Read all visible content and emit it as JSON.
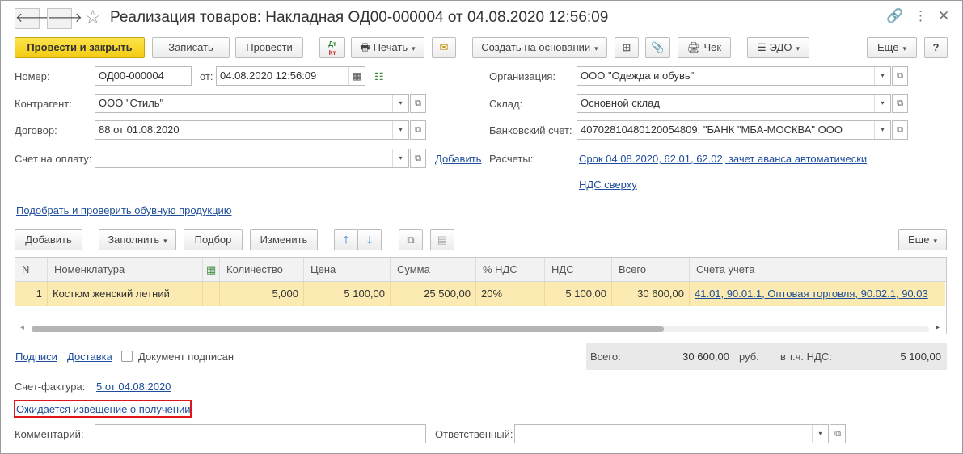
{
  "window": {
    "title": "Реализация товаров: Накладная ОД00-000004 от 04.08.2020 12:56:09",
    "icons": [
      "back-arrow-icon",
      "forward-arrow-icon",
      "star-icon",
      "link-icon",
      "more-vertical-icon",
      "close-icon"
    ],
    "glyphs": {
      "back": "🡐",
      "forward": "🡒",
      "star": "☆",
      "link": "🔗",
      "more": "⋮",
      "close": "✕"
    }
  },
  "toolbar": {
    "post_close": "Провести и закрыть",
    "save": "Записать",
    "post": "Провести",
    "dtkt_top": "Дт",
    "dtkt_bottom": "Кт",
    "print": "Печать",
    "create_based": "Создать на основании",
    "receipt": "Чек",
    "edo": "ЭДО",
    "more": "Еще",
    "help": "?",
    "print_glyph": "🖶",
    "mail_glyph": "✉",
    "struct_glyph": "⊞",
    "clip_glyph": "📎",
    "receipt_glyph": "🖨",
    "edo_glyph": "☰",
    "arrow_glyph": "▾"
  },
  "form": {
    "number_label": "Номер:",
    "number_value": "ОД00-000004",
    "date_label": "от:",
    "date_value": "04.08.2020 12:56:09",
    "calendar_glyph": "▦",
    "status_glyph": "☷",
    "org_label": "Организация:",
    "org_value": "ООО \"Одежда и обувь\"",
    "contractor_label": "Контрагент:",
    "contractor_value": "ООО \"Стиль\"",
    "warehouse_label": "Склад:",
    "warehouse_value": "Основной склад",
    "contract_label": "Договор:",
    "contract_value": "88 от 01.08.2020",
    "bank_label": "Банковский счет:",
    "bank_value": "40702810480120054809, \"БАНК \"МБА-МОСКВА\" ООО",
    "invoice_pay_label": "Счет на оплату:",
    "invoice_pay_value": "",
    "add_link": "Добавить",
    "settlements_label": "Расчеты:",
    "settlements_link": "Срок 04.08.2020, 62.01, 62.02, зачет аванса автоматически",
    "vat_link": "НДС сверху",
    "shoes_link": "Подобрать и проверить обувную продукцию",
    "dd_glyph": "▾",
    "open_glyph": "⧉"
  },
  "table_toolbar": {
    "add": "Добавить",
    "fill": "Заполнить",
    "pick": "Подбор",
    "change": "Изменить",
    "more": "Еще",
    "up_glyph": "🡑",
    "down_glyph": "🡓",
    "copy_glyph": "⧉",
    "paste_glyph": "▤"
  },
  "table": {
    "columns": [
      "N",
      "Номенклатура",
      "Количество",
      "Цена",
      "Сумма",
      "% НДС",
      "НДС",
      "Всего",
      "Счета учета"
    ],
    "rows": [
      {
        "n": "1",
        "item": "Костюм женский летний",
        "qty": "5,000",
        "price": "5 100,00",
        "sum": "25 500,00",
        "vat_rate": "20%",
        "vat": "5 100,00",
        "total": "30 600,00",
        "accounts": "41.01, 90.01.1, Оптовая торговля, 90.02.1, 90.03"
      }
    ],
    "scroll_left": "◂",
    "scroll_right": "▸"
  },
  "bottom": {
    "signatures_link": "Подписи",
    "delivery_link": "Доставка",
    "signed_label": "Документ подписан",
    "total_label": "Всего:",
    "total_value": "30 600,00",
    "currency": "руб.",
    "vat_incl_label": "в т.ч. НДС:",
    "vat_incl_value": "5 100,00",
    "invoice_label": "Счет-фактура:",
    "invoice_link": "5 от 04.08.2020",
    "notice_link": "Ожидается извещение о получении",
    "comment_label": "Комментарий:",
    "comment_value": "",
    "responsible_label": "Ответственный:",
    "responsible_value": ""
  }
}
